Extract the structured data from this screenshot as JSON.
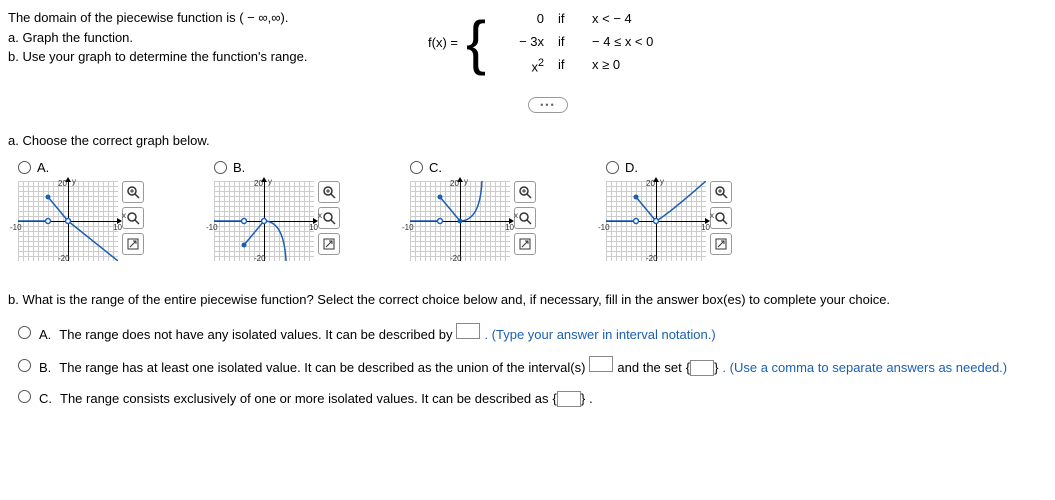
{
  "problem": {
    "domain_line": "The domain of the piecewise function is ( − ∞,∞).",
    "part_a": "a. Graph the function.",
    "part_b": "b. Use your graph to determine the function's range.",
    "fx": "f(x) =",
    "pieces": [
      {
        "expr": "0",
        "if": "if",
        "cond": "x < − 4"
      },
      {
        "expr": "− 3x",
        "if": "if",
        "cond": "− 4 ≤ x < 0"
      },
      {
        "expr_html": "x²",
        "if": "if",
        "cond": "x ≥ 0"
      }
    ]
  },
  "sectionA": {
    "prompt": "a. Choose the correct graph below.",
    "choices": [
      "A.",
      "B.",
      "C.",
      "D."
    ],
    "graph_labels": {
      "ytop": "20",
      "ybot": "-20",
      "xl": "-10",
      "xr": "10",
      "x": "x",
      "y": "y"
    },
    "tools": {
      "zoom_in": "zoom-in",
      "zoom_out": "zoom-out",
      "expand": "expand"
    }
  },
  "sectionB": {
    "prompt": "b. What is the range of the entire piecewise function? Select the correct choice below and, if necessary, fill in the answer box(es) to complete your choice.",
    "options": {
      "A": {
        "label": "A.",
        "text1": "The range does not have any isolated values. It can be described by",
        "hint": ". (Type your answer in interval notation.)"
      },
      "B": {
        "label": "B.",
        "text1": "The range has at least one isolated value. It can be described as the union of the interval(s)",
        "text2": "and the set",
        "hint": ". (Use a comma to separate answers as needed.)"
      },
      "C": {
        "label": "C.",
        "text1": "The range consists exclusively of one or more isolated values. It can be described as",
        "text2": "."
      }
    }
  },
  "ellipsis": "•••"
}
